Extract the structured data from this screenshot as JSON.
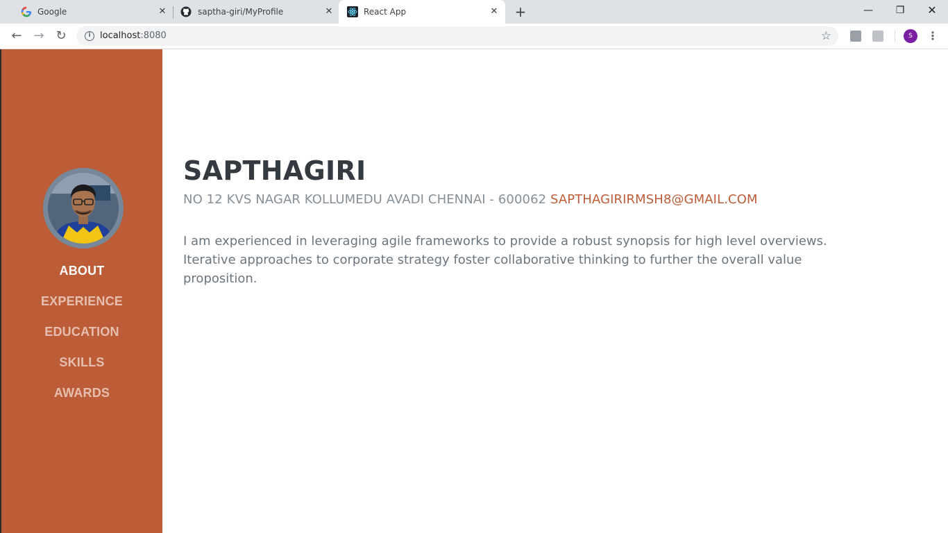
{
  "browser": {
    "tabs": [
      {
        "title": "Google",
        "icon": "google-icon",
        "active": false
      },
      {
        "title": "saptha-giri/MyProfile",
        "icon": "github-icon",
        "active": false
      },
      {
        "title": "React App",
        "icon": "react-icon",
        "active": true
      }
    ],
    "new_tab_glyph": "+",
    "close_glyph": "✕",
    "window_controls": {
      "minimize": "—",
      "restore": "❐",
      "close": "✕"
    },
    "nav": {
      "back": "←",
      "forward": "→",
      "reload": "↻"
    },
    "address": {
      "host": "localhost",
      "port": ":8080"
    },
    "bookmark_glyph": "☆",
    "profile_initial": "S",
    "menu_glyph": "⋮"
  },
  "sidebar": {
    "accent": "#bd5d38",
    "nav_items": [
      {
        "label": "ABOUT",
        "active": true
      },
      {
        "label": "EXPERIENCE",
        "active": false
      },
      {
        "label": "EDUCATION",
        "active": false
      },
      {
        "label": "SKILLS",
        "active": false
      },
      {
        "label": "AWARDS",
        "active": false
      }
    ]
  },
  "about": {
    "name": "SAPTHAGIRI",
    "address": "NO 12 KVS NAGAR KOLLUMEDU AVADI CHENNAI - 600062",
    "email": "SAPTHAGIRIRMSH8@GMAIL.COM",
    "lead": "I am experienced in leveraging agile frameworks to provide a robust synopsis for high level overviews. Iterative approaches to corporate strategy foster collaborative thinking to further the overall value proposition."
  }
}
